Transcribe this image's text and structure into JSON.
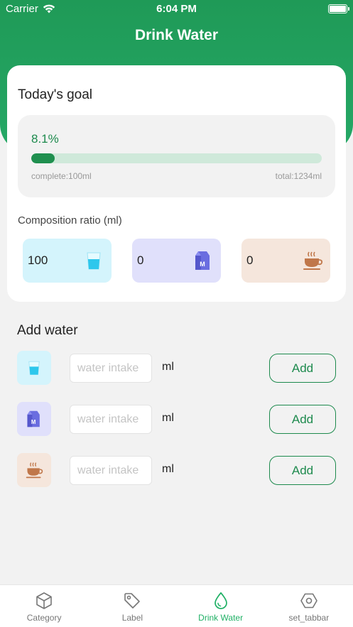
{
  "status_bar": {
    "carrier": "Carrier",
    "time": "6:04 PM"
  },
  "header": {
    "title": "Drink Water"
  },
  "goal": {
    "title": "Today's goal",
    "percent_text": "8.1%",
    "progress": 0.081,
    "complete_text": "complete:100ml",
    "total_text": "total:1234ml"
  },
  "ratio": {
    "title": "Composition ratio (ml)",
    "items": [
      {
        "value": "100",
        "icon": "water-glass-icon",
        "bg": "#d4f4fc"
      },
      {
        "value": "0",
        "icon": "milk-carton-icon",
        "bg": "#e0e0fb"
      },
      {
        "value": "0",
        "icon": "coffee-cup-icon",
        "bg": "#f5e6dc"
      }
    ]
  },
  "add_water": {
    "title": "Add water",
    "rows": [
      {
        "icon": "water-glass-icon",
        "placeholder": "water intake",
        "unit": "ml",
        "button": "Add"
      },
      {
        "icon": "milk-carton-icon",
        "placeholder": "water intake",
        "unit": "ml",
        "button": "Add"
      },
      {
        "icon": "coffee-cup-icon",
        "placeholder": "water intake",
        "unit": "ml",
        "button": "Add"
      }
    ]
  },
  "tabbar": {
    "items": [
      {
        "label": "Category",
        "icon": "cube-icon",
        "active": false
      },
      {
        "label": "Label",
        "icon": "tag-icon",
        "active": false
      },
      {
        "label": "Drink Water",
        "icon": "water-drop-icon",
        "active": true
      },
      {
        "label": "set_tabbar",
        "icon": "hexagon-settings-icon",
        "active": false
      }
    ]
  },
  "colors": {
    "brand_green": "#1f9a57",
    "active_tab": "#1fb065"
  }
}
